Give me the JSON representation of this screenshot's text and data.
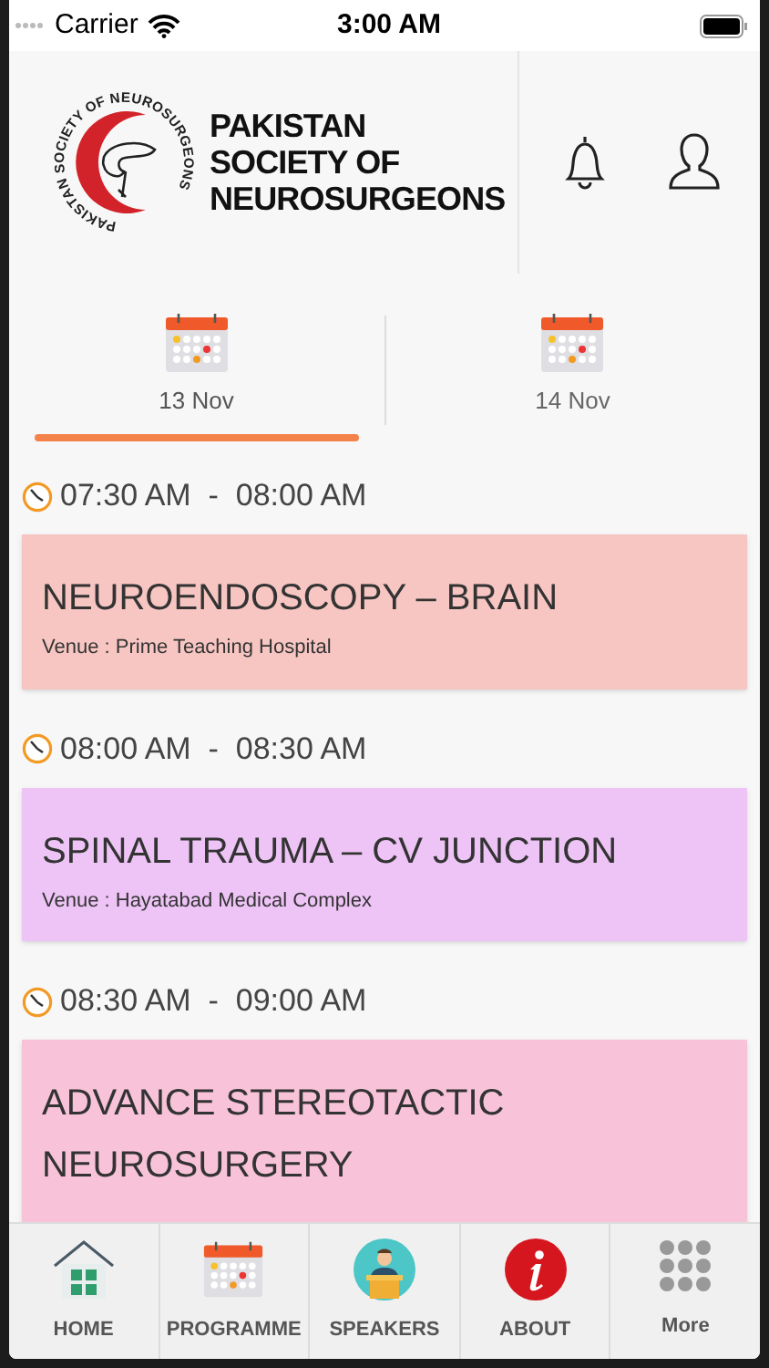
{
  "status_bar": {
    "carrier": "Carrier",
    "time": "3:00 AM"
  },
  "header": {
    "logo_ring_text": "PAKISTAN SOCIETY OF NEUROSURGEONS",
    "title_lines": [
      "PAKISTAN",
      "SOCIETY OF",
      "NEUROSURGEONS"
    ]
  },
  "date_tabs": [
    {
      "label": "13 Nov",
      "selected": true
    },
    {
      "label": "14 Nov",
      "selected": false
    }
  ],
  "sessions": [
    {
      "start": "07:30 AM",
      "separator": "-",
      "end": "08:00 AM",
      "title": "NEUROENDOSCOPY – BRAIN",
      "venue": "Venue : Prime Teaching Hospital",
      "color": "#f7c6c2"
    },
    {
      "start": "08:00 AM",
      "separator": "-",
      "end": "08:30 AM",
      "title": "SPINAL TRAUMA – CV JUNCTION",
      "venue": "Venue : Hayatabad Medical Complex",
      "color": "#eec4f6"
    },
    {
      "start": "08:30 AM",
      "separator": "-",
      "end": "09:00 AM",
      "title": "ADVANCE STEREOTACTIC NEUROSURGERY",
      "color": "#f8c3d8"
    }
  ],
  "tab_bar": [
    {
      "label": "HOME",
      "kind": "home"
    },
    {
      "label": "PROGRAMME",
      "kind": "calendar"
    },
    {
      "label": "SPEAKERS",
      "kind": "speaker"
    },
    {
      "label": "ABOUT",
      "kind": "info"
    },
    {
      "label": "More",
      "kind": "grid"
    }
  ]
}
